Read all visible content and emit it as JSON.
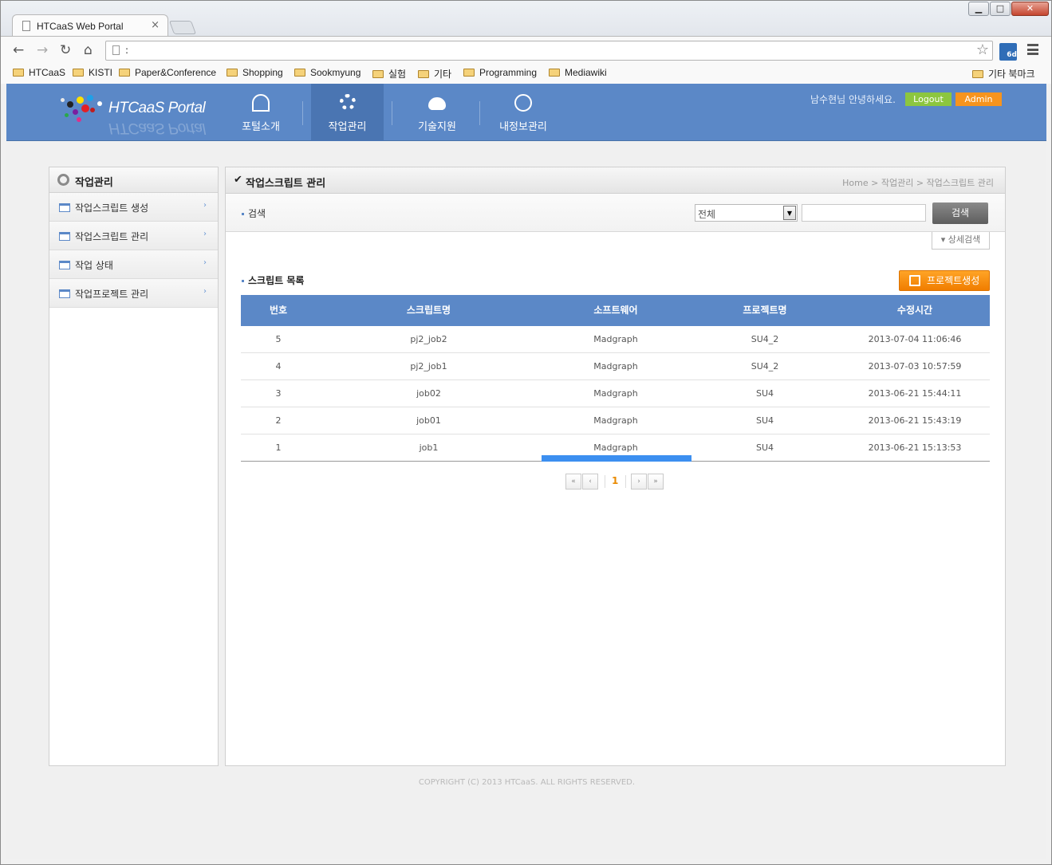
{
  "browser": {
    "tab_title": "HTCaaS Web Portal",
    "tab_close": "×",
    "url": ":",
    "window_controls": {
      "minimize": "▁",
      "maximize": "□",
      "close": "✕"
    },
    "extension_badge": "6d",
    "nav": {
      "back": "←",
      "forward": "→",
      "reload": "↻",
      "home": "⌂"
    },
    "star": "☆",
    "bookmarks": [
      "HTCaaS",
      "KISTI",
      "Paper&Conference",
      "Shopping",
      "Sookmyung",
      "실험",
      "기타",
      "Programming",
      "Mediawiki"
    ],
    "other_bookmarks": "기타 북마크"
  },
  "header": {
    "logo": "HTCaaS Portal",
    "menu": [
      {
        "label": "포털소개",
        "icon": "signal-icon"
      },
      {
        "label": "작업관리",
        "icon": "gear-icon",
        "active": true
      },
      {
        "label": "기술지원",
        "icon": "cloud-icon"
      },
      {
        "label": "내정보관리",
        "icon": "chat-icon"
      }
    ],
    "greeting": "남수현님 안녕하세요.",
    "logout": "Logout",
    "admin": "Admin",
    "colors": {
      "bar": "#5b88c7",
      "logout": "#8cc63f",
      "admin": "#f7941d"
    }
  },
  "sidebar": {
    "title": "작업관리",
    "items": [
      {
        "label": "작업스크립트 생성"
      },
      {
        "label": "작업스크립트 관리"
      },
      {
        "label": "작업 상태"
      },
      {
        "label": "작업프로젝트 관리"
      }
    ],
    "arrow": "›"
  },
  "main": {
    "check": "✔",
    "title": "작업스크립트 관리",
    "breadcrumb": "Home > 작업관리 > 작업스크립트 관리",
    "search": {
      "label": "검색",
      "select_value": "전체",
      "input_value": "",
      "button": "검색",
      "detail_button": "▾ 상세검색"
    },
    "list_title": "스크립트 목록",
    "create_button": "프로젝트생성",
    "table": {
      "headers": [
        "번호",
        "스크립트명",
        "소프트웨어",
        "프로젝트명",
        "수정시간"
      ],
      "rows": [
        [
          "5",
          "pj2_job2",
          "Madgraph",
          "SU4_2",
          "2013-07-04 11:06:46"
        ],
        [
          "4",
          "pj2_job1",
          "Madgraph",
          "SU4_2",
          "2013-07-03 10:57:59"
        ],
        [
          "3",
          "job02",
          "Madgraph",
          "SU4",
          "2013-06-21 15:44:11"
        ],
        [
          "2",
          "job01",
          "Madgraph",
          "SU4",
          "2013-06-21 15:43:19"
        ],
        [
          "1",
          "job1",
          "Madgraph",
          "SU4",
          "2013-06-21 15:13:53"
        ]
      ]
    },
    "pagination": {
      "first": "«",
      "prev": "‹",
      "current": "1",
      "next": "›",
      "last": "»"
    }
  },
  "footer": {
    "copyright": "COPYRIGHT (C) 2013 HTCaaS. ALL RIGHTS RESERVED."
  }
}
